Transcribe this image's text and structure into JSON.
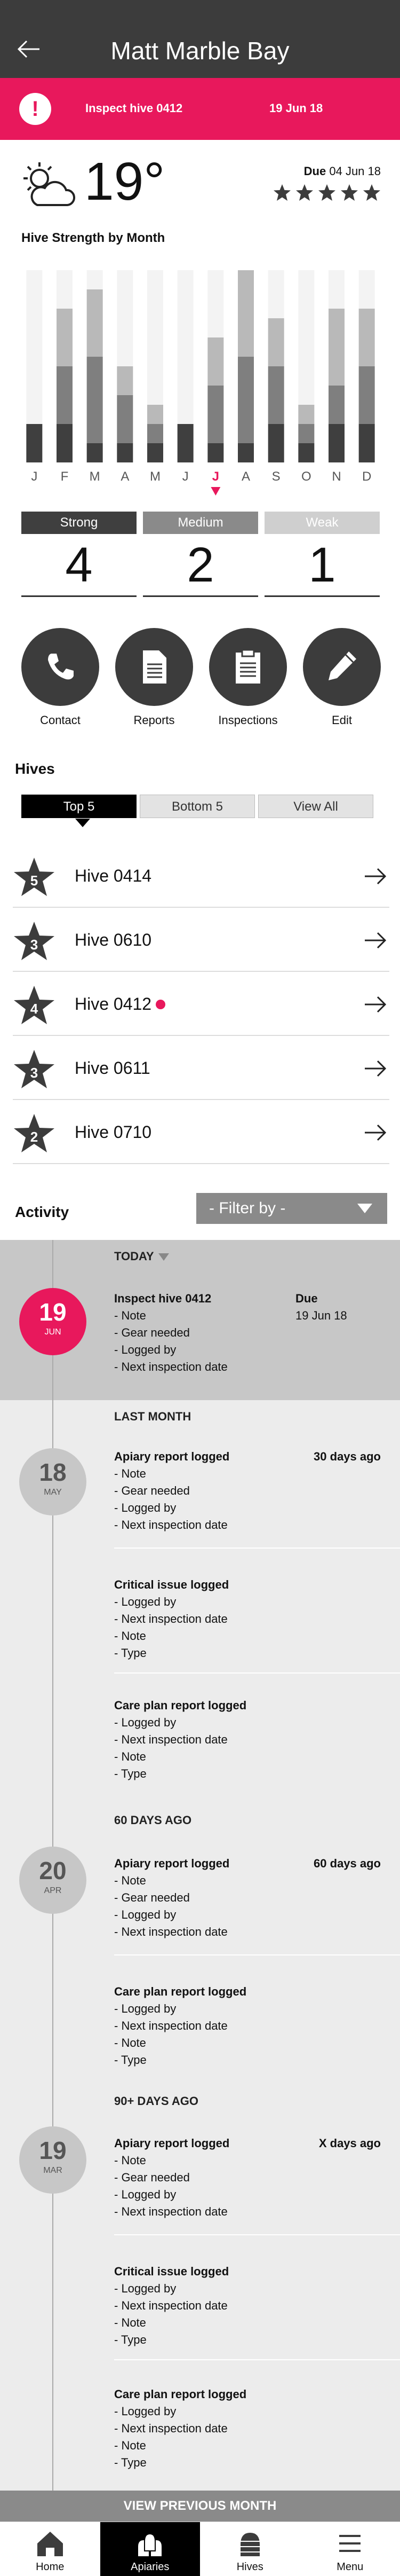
{
  "header": {
    "title": "Matt Marble Bay",
    "back_icon": "arrow-left-icon"
  },
  "alert": {
    "message": "Inspect hive 0412",
    "date": "19 Jun 18",
    "icon": "exclamation-icon"
  },
  "weather": {
    "icon": "partly-cloudy-icon",
    "temperature": "19°"
  },
  "due": {
    "label": "Due",
    "date": "04 Jun 18",
    "rating": 5,
    "rating_max": 5
  },
  "strength_label": "Hive Strength by Month",
  "chart_data": {
    "type": "bar",
    "stacked": true,
    "categories": [
      "J",
      "F",
      "M",
      "A",
      "M",
      "J",
      "J",
      "A",
      "S",
      "O",
      "N",
      "D"
    ],
    "series": [
      {
        "name": "Strong",
        "values": [
          20,
          20,
          10,
          10,
          10,
          20,
          10,
          10,
          20,
          10,
          20,
          20
        ]
      },
      {
        "name": "Medium",
        "values": [
          0,
          30,
          45,
          25,
          10,
          0,
          30,
          45,
          30,
          10,
          20,
          30
        ]
      },
      {
        "name": "Weak",
        "values": [
          0,
          30,
          35,
          15,
          10,
          0,
          25,
          45,
          25,
          10,
          40,
          30
        ]
      }
    ],
    "ylim": [
      0,
      100
    ],
    "highlight_index": 6,
    "colors": {
      "Strong": "#3f3f3f",
      "Medium": "#7f7f7f",
      "Weak": "#b9b9b9",
      "track": "#f3f3f3",
      "highlight": "#e8185c"
    }
  },
  "counts": [
    {
      "label": "Strong",
      "value": "4"
    },
    {
      "label": "Medium",
      "value": "2"
    },
    {
      "label": "Weak",
      "value": "1"
    }
  ],
  "actions": [
    {
      "label": "Contact",
      "icon": "phone-icon"
    },
    {
      "label": "Reports",
      "icon": "document-icon"
    },
    {
      "label": "Inspections",
      "icon": "clipboard-icon"
    },
    {
      "label": "Edit",
      "icon": "pencil-icon"
    }
  ],
  "hives": {
    "title": "Hives",
    "tabs": [
      "Top 5",
      "Bottom 5",
      "View All"
    ],
    "items": [
      {
        "rank": "5",
        "name": "Hive 0414",
        "alert": false
      },
      {
        "rank": "3",
        "name": "Hive 0610",
        "alert": false
      },
      {
        "rank": "4",
        "name": "Hive 0412",
        "alert": true
      },
      {
        "rank": "3",
        "name": "Hive 0611",
        "alert": false
      },
      {
        "rank": "2",
        "name": "Hive 0710",
        "alert": false
      }
    ]
  },
  "activity": {
    "title": "Activity",
    "filter": "- Filter by  -",
    "sections": {
      "today": "TODAY",
      "last_month": "LAST MONTH",
      "sixty": "60 DAYS AGO",
      "ninety": "90+ DAYS AGO"
    },
    "dates": [
      {
        "day": "19",
        "month": "JUN"
      },
      {
        "day": "18",
        "month": "MAY"
      },
      {
        "day": "20",
        "month": "APR"
      },
      {
        "day": "19",
        "month": "MAR"
      }
    ],
    "items": [
      {
        "title": "Inspect hive 0412",
        "right": "Due",
        "right2": "19 Jun 18",
        "lines": [
          "- Note",
          "- Gear needed",
          "- Logged by",
          "- Next inspection date"
        ]
      },
      {
        "title": "Apiary report logged",
        "right": "30 days ago",
        "lines": [
          "- Note",
          "- Gear needed",
          "- Logged by",
          "- Next inspection date"
        ]
      },
      {
        "title": "Critical issue logged",
        "lines": [
          "- Logged by",
          "- Next inspection date",
          "- Note",
          "- Type"
        ]
      },
      {
        "title": "Care plan report logged",
        "lines": [
          "- Logged by",
          "- Next inspection date",
          "- Note",
          "- Type"
        ]
      },
      {
        "title": "Apiary report logged",
        "right": "60 days ago",
        "lines": [
          "- Note",
          "- Gear needed",
          "- Logged by",
          "- Next inspection date"
        ]
      },
      {
        "title": "Care plan report logged",
        "lines": [
          "- Logged by",
          "- Next inspection date",
          "- Note",
          "- Type"
        ]
      },
      {
        "title": "Apiary report logged",
        "right": "X days ago",
        "lines": [
          "- Note",
          "- Gear needed",
          "- Logged by",
          "- Next inspection date"
        ]
      },
      {
        "title": "Critical issue logged",
        "lines": [
          "- Logged by",
          "- Next inspection date",
          "- Note",
          "- Type"
        ]
      },
      {
        "title": "Care plan report logged",
        "lines": [
          "- Logged by",
          "- Next inspection date",
          "- Note",
          "- Type"
        ]
      }
    ],
    "view_previous": "VIEW PREVIOUS MONTH"
  },
  "tabbar": [
    {
      "label": "Home",
      "icon": "home-icon",
      "active": false
    },
    {
      "label": "Apiaries",
      "icon": "apiary-icon",
      "active": true
    },
    {
      "label": "Hives",
      "icon": "hive-icon",
      "active": false
    },
    {
      "label": "Menu",
      "icon": "menu-icon",
      "active": false
    }
  ]
}
